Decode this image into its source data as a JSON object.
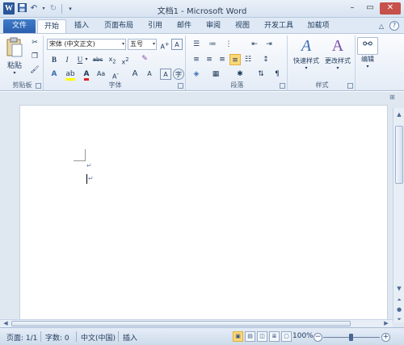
{
  "window": {
    "title": "文档1 - Microsoft Word",
    "logo": "W",
    "qat": {
      "save_icon": "save-icon",
      "undo_icon": "undo-icon",
      "redo_icon": "redo-icon",
      "customize_icon": "customize-icon"
    }
  },
  "tabs": [
    {
      "label": "文件"
    },
    {
      "label": "开始"
    },
    {
      "label": "插入"
    },
    {
      "label": "页面布局"
    },
    {
      "label": "引用"
    },
    {
      "label": "邮件"
    },
    {
      "label": "审阅"
    },
    {
      "label": "视图"
    },
    {
      "label": "开发工具"
    },
    {
      "label": "加载项"
    }
  ],
  "ribbon": {
    "clipboard": {
      "paste_label": "粘贴",
      "group_label": "剪贴板"
    },
    "font": {
      "font_name": "宋体 (中文正文)",
      "font_size": "五号",
      "group_label": "字体"
    },
    "paragraph": {
      "group_label": "段落"
    },
    "styles": {
      "quick_styles_label": "快速样式",
      "change_styles_label": "更改样式",
      "group_label": "样式"
    },
    "editing": {
      "label": "编辑"
    }
  },
  "statusbar": {
    "page": "页面: 1/1",
    "words": "字数: 0",
    "language": "中文(中国)",
    "mode": "插入",
    "zoom": "100%"
  },
  "colors": {
    "file_tab": "#2a5fae",
    "highlight": "#fbd877",
    "word_logo": "#2a5699"
  }
}
